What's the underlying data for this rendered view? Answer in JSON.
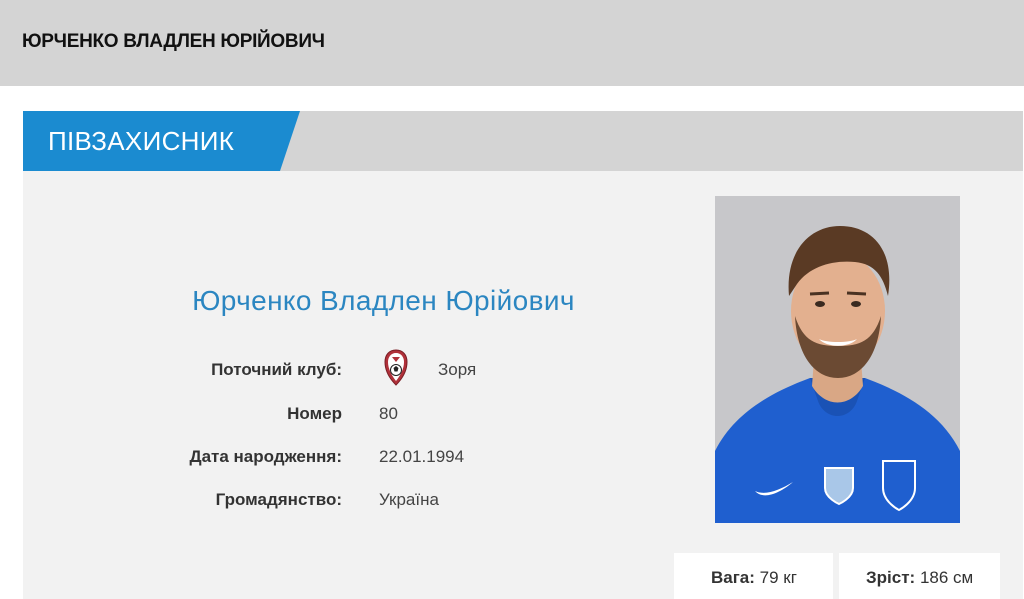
{
  "header": {
    "title": "ЮРЧЕНКО ВЛАДЛЕН ЮРІЙОВИЧ"
  },
  "card": {
    "position": "ПІВЗАХИСНИК",
    "player_name": "Юрченко Владлен Юрійович",
    "rows": [
      {
        "label": "Поточний клуб:",
        "value": "Зоря",
        "icon": "club-crest-icon"
      },
      {
        "label": "Номер",
        "value": "80"
      },
      {
        "label": "Дата народження:",
        "value": "22.01.1994"
      },
      {
        "label": "Громадянство:",
        "value": "Україна"
      }
    ],
    "stats": {
      "weight_label": "Вага:",
      "weight_value": "79 кг",
      "height_label": "Зріст:",
      "height_value": "186 см"
    }
  },
  "colors": {
    "accent": "#1b8bd0",
    "name": "#2b86c1",
    "header_bg": "#d4d4d4",
    "card_bg": "#f2f2f2"
  }
}
